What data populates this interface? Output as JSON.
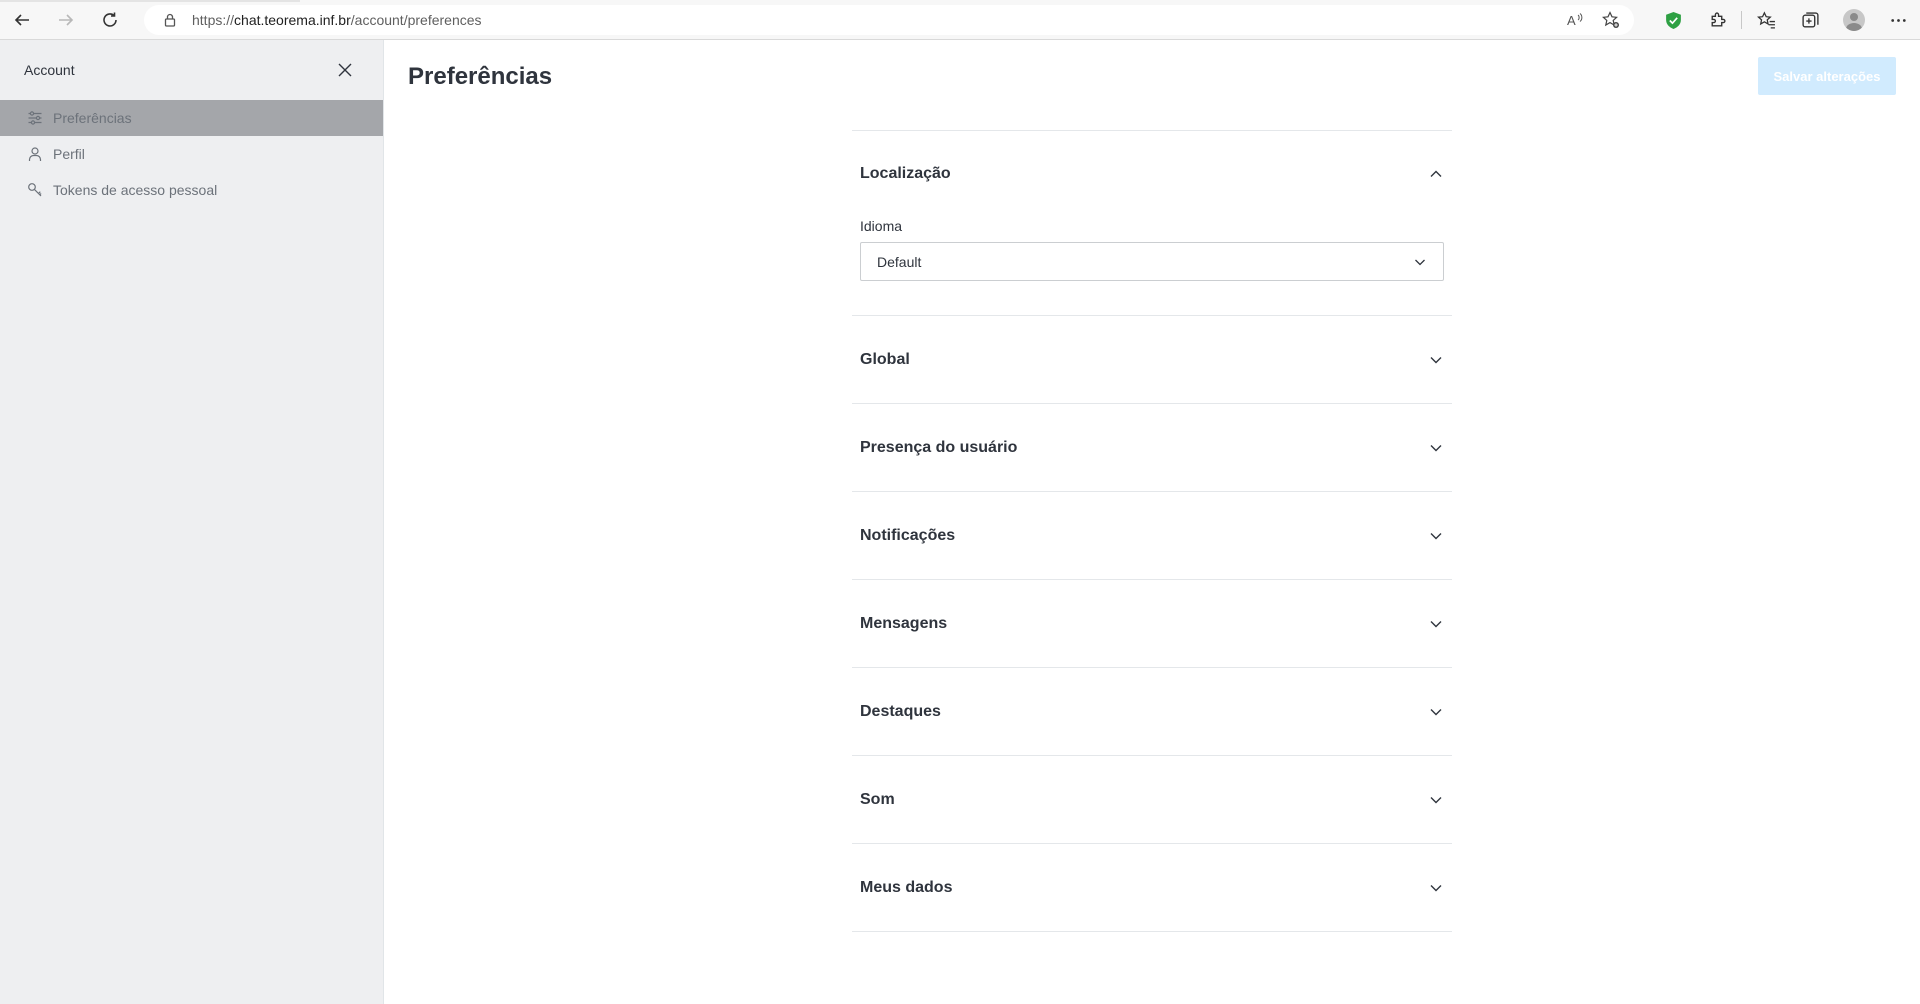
{
  "browser": {
    "url_prefix": "https://",
    "url_host": "chat.teorema.inf.br",
    "url_path": "/account/preferences",
    "icons": [
      "back-icon",
      "forward-icon",
      "refresh-icon",
      "lock-icon",
      "read-aloud-icon",
      "add-favorite-icon",
      "shield-extension-icon",
      "extensions-icon",
      "favorites-icon",
      "collections-icon",
      "profile-icon",
      "more-icon"
    ]
  },
  "sidebar": {
    "title": "Account",
    "items": [
      {
        "label": "Preferências",
        "icon": "sliders-icon",
        "active": true
      },
      {
        "label": "Perfil",
        "icon": "user-icon",
        "active": false
      },
      {
        "label": "Tokens de acesso pessoal",
        "icon": "key-icon",
        "active": false
      }
    ]
  },
  "main": {
    "title": "Preferências",
    "save_label": "Salvar alterações",
    "sections": [
      {
        "title": "Localização",
        "expanded": true
      },
      {
        "title": "Global",
        "expanded": false
      },
      {
        "title": "Presença do usuário",
        "expanded": false
      },
      {
        "title": "Notificações",
        "expanded": false
      },
      {
        "title": "Mensagens",
        "expanded": false
      },
      {
        "title": "Destaques",
        "expanded": false
      },
      {
        "title": "Som",
        "expanded": false
      },
      {
        "title": "Meus dados",
        "expanded": false
      }
    ],
    "localization": {
      "language_label": "Idioma",
      "language_value": "Default"
    }
  },
  "colors": {
    "sidebar_bg": "#eeeff1",
    "sidebar_active": "#a4a6aa",
    "save_button_disabled": "#d1ebfe",
    "text_primary": "#2f343d",
    "divider": "#e4e7ea"
  }
}
